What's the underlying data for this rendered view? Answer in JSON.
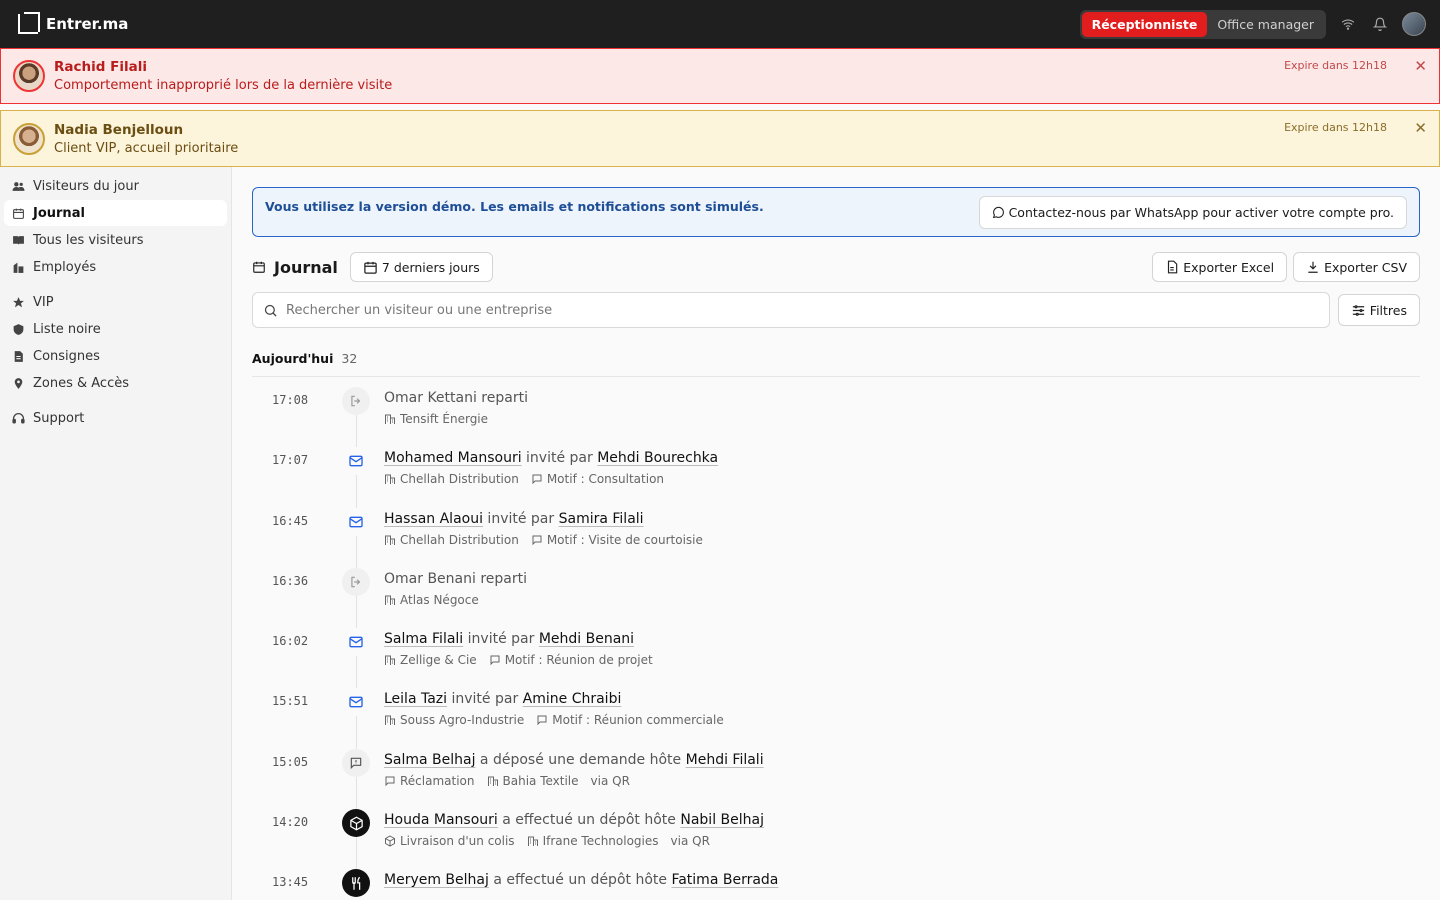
{
  "app": {
    "name": "Entrer.ma"
  },
  "roles": [
    "Réceptionniste",
    "Office manager"
  ],
  "alerts": [
    {
      "name": "Rachid Filali",
      "message": "Comportement inapproprié lors de la dernière visite",
      "expire": "Expire dans 12h18"
    },
    {
      "name": "Nadia Benjelloun",
      "message": "Client VIP, accueil prioritaire",
      "expire": "Expire dans 12h18"
    }
  ],
  "sidebar": {
    "items": [
      {
        "label": "Visiteurs du jour",
        "icon": "users-icon"
      },
      {
        "label": "Journal",
        "icon": "calendar-icon"
      },
      {
        "label": "Tous les visiteurs",
        "icon": "book-icon"
      },
      {
        "label": "Employés",
        "icon": "building-icon"
      },
      {
        "label": "VIP",
        "icon": "star-icon"
      },
      {
        "label": "Liste noire",
        "icon": "shield-icon"
      },
      {
        "label": "Consignes",
        "icon": "document-icon"
      },
      {
        "label": "Zones & Accès",
        "icon": "pin-icon"
      },
      {
        "label": "Support",
        "icon": "headset-icon"
      }
    ]
  },
  "demo": {
    "text": "Vous utilisez la version démo. Les emails et notifications sont simulés.",
    "button": "Contactez-nous par WhatsApp pour activer votre compte pro."
  },
  "toolbar": {
    "title": "Journal",
    "range": "7 derniers jours",
    "export_excel": "Exporter Excel",
    "export_csv": "Exporter CSV",
    "filters": "Filtres"
  },
  "search": {
    "placeholder": "Rechercher un visiteur ou une entreprise"
  },
  "day": {
    "label": "Aujourd'hui",
    "count": "32"
  },
  "entries": [
    {
      "time": "17:08",
      "icon": "exit-icon",
      "visitor": "Omar Kettani",
      "verb": " reparti",
      "host": "",
      "meta": [
        "Tensift Énergie"
      ]
    },
    {
      "time": "17:07",
      "icon": "mail-icon",
      "visitor": "Mohamed Mansouri",
      "verb": " invité par ",
      "host": "Mehdi Bourechka",
      "meta": [
        "Chellah Distribution",
        "Motif : Consultation"
      ]
    },
    {
      "time": "16:45",
      "icon": "mail-icon",
      "visitor": "Hassan Alaoui",
      "verb": " invité par ",
      "host": "Samira Filali",
      "meta": [
        "Chellah Distribution",
        "Motif : Visite de courtoisie"
      ]
    },
    {
      "time": "16:36",
      "icon": "exit-icon",
      "visitor": "Omar Benani",
      "verb": " reparti",
      "host": "",
      "meta": [
        "Atlas Négoce"
      ]
    },
    {
      "time": "16:02",
      "icon": "mail-icon",
      "visitor": "Salma Filali",
      "verb": " invité par ",
      "host": "Mehdi Benani",
      "meta": [
        "Zellige & Cie",
        "Motif : Réunion de projet"
      ]
    },
    {
      "time": "15:51",
      "icon": "mail-icon",
      "visitor": "Leila Tazi",
      "verb": " invité par ",
      "host": "Amine Chraibi",
      "meta": [
        "Souss Agro-Industrie",
        "Motif : Réunion commerciale"
      ]
    },
    {
      "time": "15:05",
      "icon": "message-alert-icon",
      "visitor": "Salma Belhaj",
      "verb": " a déposé une demande hôte ",
      "host": "Mehdi Filali",
      "meta": [
        "Réclamation",
        "Bahia Textile",
        "via QR"
      ]
    },
    {
      "time": "14:20",
      "icon": "package-icon",
      "visitor": "Houda Mansouri",
      "verb": " a effectué un dépôt hôte ",
      "host": "Nabil Belhaj",
      "meta": [
        "Livraison d'un colis",
        "Ifrane Technologies",
        "via QR"
      ]
    },
    {
      "time": "13:45",
      "icon": "utensils-icon",
      "visitor": "Meryem Belhaj",
      "verb": " a effectué un dépôt hôte ",
      "host": "Fatima Berrada",
      "meta": []
    }
  ]
}
